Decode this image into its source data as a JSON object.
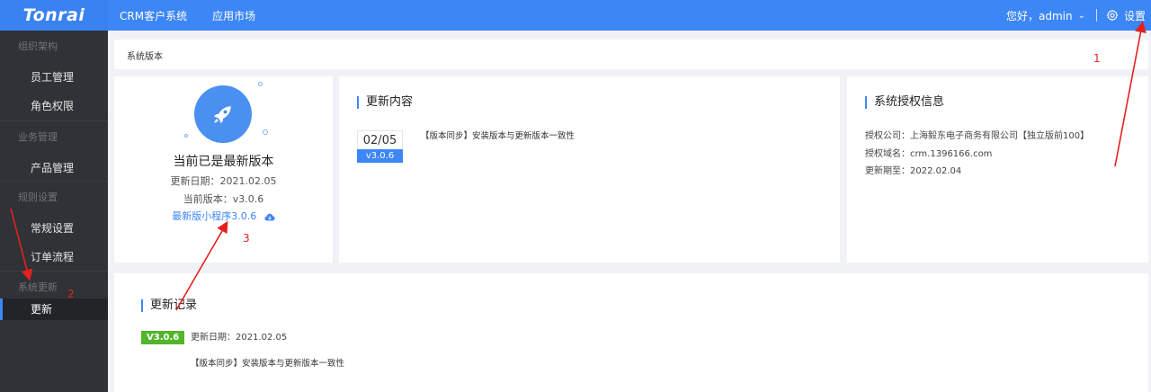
{
  "brand": {
    "logo": "Tonrai"
  },
  "topnav": {
    "items": [
      "CRM客户系统",
      "应用市场"
    ]
  },
  "user": {
    "greeting": "您好，admin",
    "settings_label": "设置"
  },
  "sidebar": {
    "groups": [
      {
        "title": "组织架构",
        "items": [
          "员工管理",
          "角色权限"
        ]
      },
      {
        "title": "业务管理",
        "items": [
          "产品管理"
        ]
      },
      {
        "title": "规则设置",
        "items": [
          "常规设置",
          "订单流程"
        ]
      },
      {
        "title": "系统更新",
        "items": [
          "更新"
        ]
      }
    ],
    "active": "更新"
  },
  "breadcrumb": {
    "title": "系统版本"
  },
  "version_card": {
    "status": "当前已是最新版本",
    "update_date": "更新日期：2021.02.05",
    "current_version": "当前版本：v3.0.6",
    "mini_program_link": "最新版小程序3.0.6"
  },
  "update_content": {
    "heading": "更新内容",
    "date": "02/05",
    "version": "v3.0.6",
    "text": "【版本同步】安装版本与更新版本一致性"
  },
  "auth_info": {
    "heading": "系统授权信息",
    "company": "授权公司：上海毅东电子商务有限公司【独立版前100】",
    "domain": "授权域名：crm.1396166.com",
    "expiry": "更新期至：2022.02.04"
  },
  "update_record": {
    "heading": "更新记录",
    "version_badge": "V3.0.6",
    "date": "更新日期：2021.02.05",
    "text": "【版本同步】安装版本与更新版本一致性"
  },
  "annotations": [
    "1",
    "2",
    "3"
  ],
  "colors": {
    "primary": "#3d86f6",
    "sidebar": "#2f3236",
    "badge_green": "#52b52a",
    "annotation_red": "#e52020"
  }
}
